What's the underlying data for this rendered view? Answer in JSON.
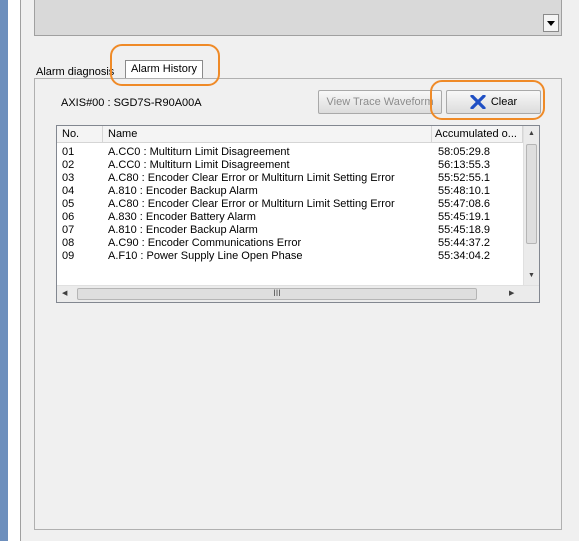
{
  "tabs": {
    "diagnosis_label": "Alarm diagnosis",
    "history_label": "Alarm History"
  },
  "axis_label": "AXIS#00 : SGD7S-R90A00A",
  "buttons": {
    "view_trace": "View Trace Waveform",
    "clear": "Clear"
  },
  "colors": {
    "highlight": "#ef8a27",
    "clear_icon": "#1f4fc4",
    "stripe": "#6d8fbd"
  },
  "table": {
    "headers": {
      "no": "No.",
      "name": "Name",
      "accumulated": "Accumulated o..."
    },
    "rows": [
      {
        "no": "01",
        "name": "A.CC0 : Multiturn Limit Disagreement",
        "time": "58:05:29.8"
      },
      {
        "no": "02",
        "name": "A.CC0 : Multiturn Limit Disagreement",
        "time": "56:13:55.3"
      },
      {
        "no": "03",
        "name": "A.C80 : Encoder Clear Error or Multiturn Limit Setting Error",
        "time": "55:52:55.1"
      },
      {
        "no": "04",
        "name": "A.810 : Encoder Backup Alarm",
        "time": "55:48:10.1"
      },
      {
        "no": "05",
        "name": "A.C80 : Encoder Clear Error or Multiturn Limit Setting Error",
        "time": "55:47:08.6"
      },
      {
        "no": "06",
        "name": "A.830 : Encoder Battery Alarm",
        "time": "55:45:19.1"
      },
      {
        "no": "07",
        "name": "A.810 : Encoder Backup Alarm",
        "time": "55:45:18.9"
      },
      {
        "no": "08",
        "name": "A.C90 : Encoder Communications Error",
        "time": "55:44:37.2"
      },
      {
        "no": "09",
        "name": "A.F10 : Power Supply Line Open Phase",
        "time": "55:34:04.2"
      }
    ]
  },
  "scrollbar": {
    "hthumb_grip": "III"
  }
}
